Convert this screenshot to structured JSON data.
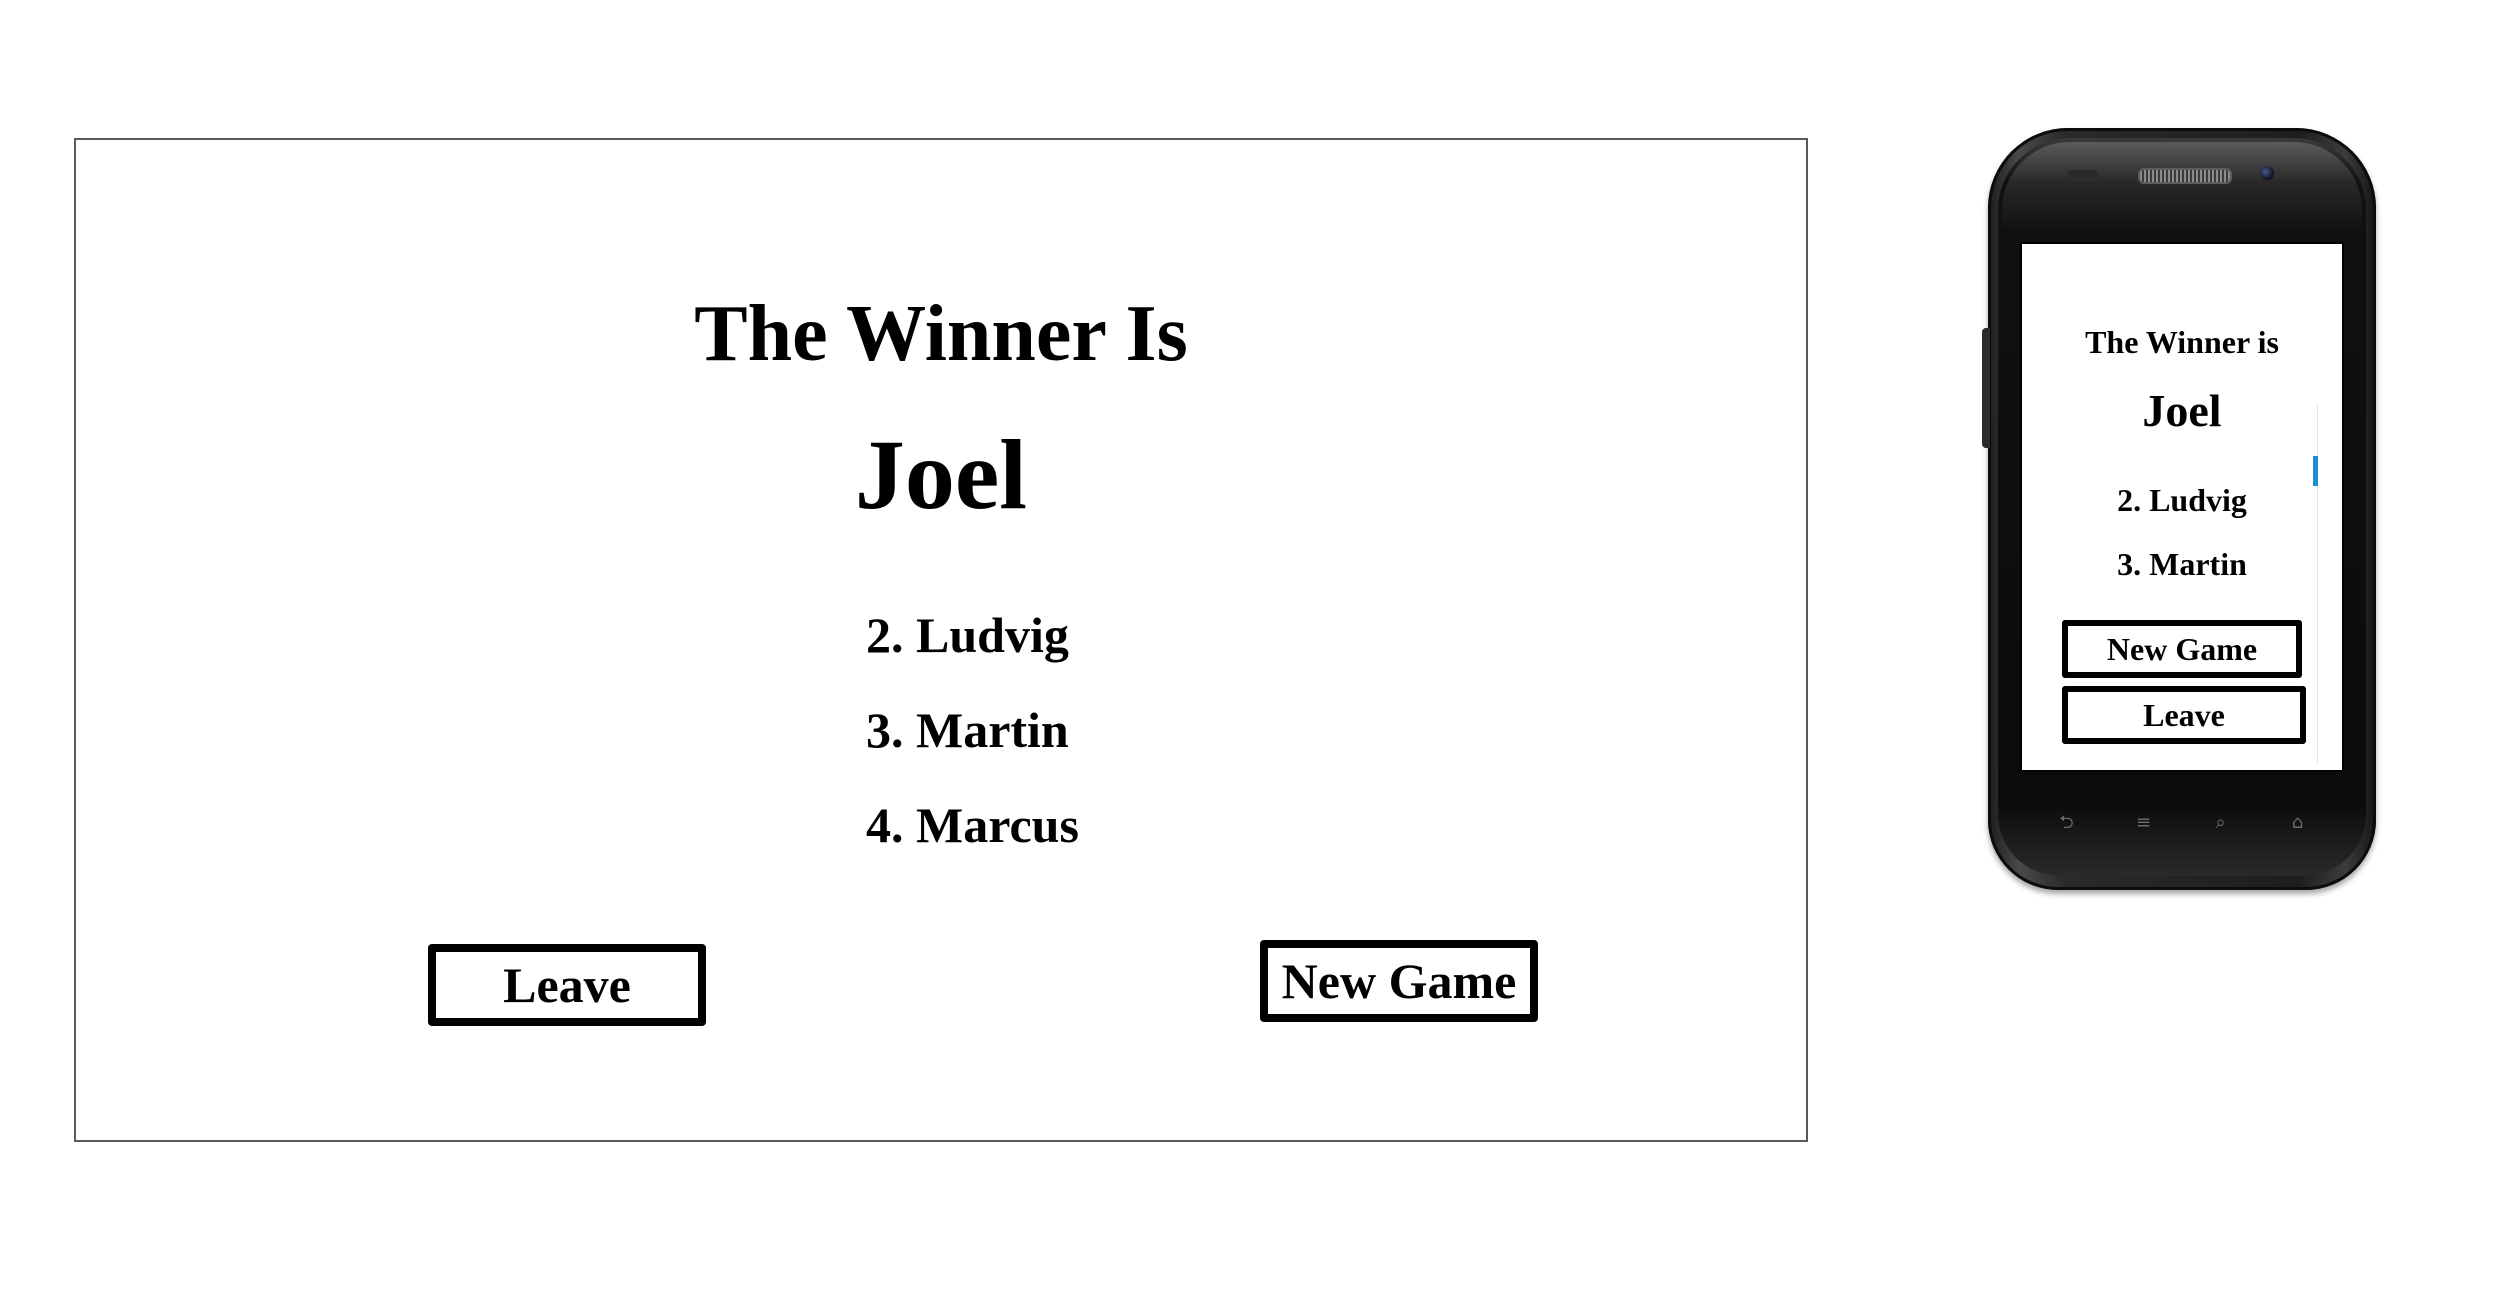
{
  "desktop": {
    "title": "The Winner Is",
    "winner": "Joel",
    "ranking": [
      "2. Ludvig",
      "3. Martin",
      "4. Marcus"
    ],
    "leave_label": "Leave",
    "new_game_label": "New Game"
  },
  "mobile": {
    "title": "The Winner is",
    "winner": "Joel",
    "ranking": [
      "2. Ludvig",
      "3. Martin"
    ],
    "new_game_label": "New Game",
    "leave_label": "Leave",
    "nav_icons": [
      "back-icon",
      "menu-icon",
      "search-icon",
      "home-icon"
    ],
    "scrollbar_color": "#1a90d0"
  }
}
